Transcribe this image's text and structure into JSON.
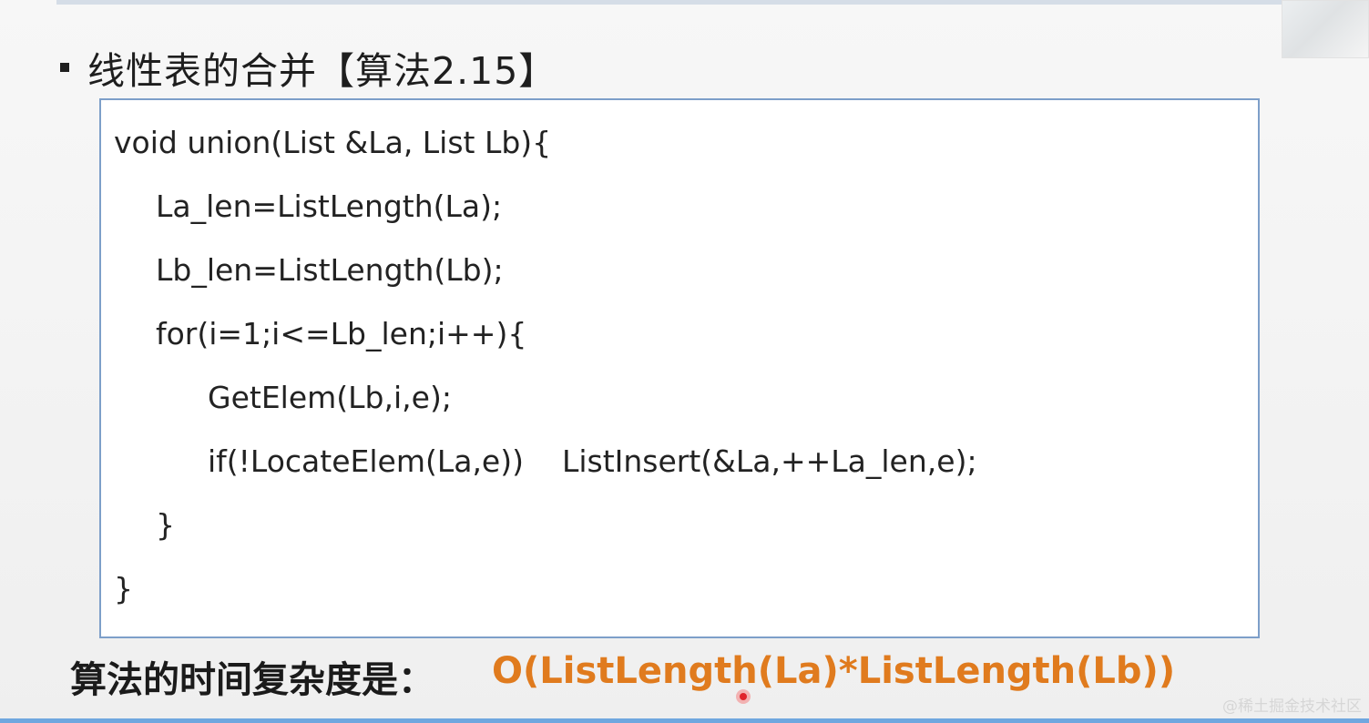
{
  "slide": {
    "heading": "线性表的合并【算法2.15】",
    "code_lines": [
      "void union(List &La, List Lb){",
      "La_len=ListLength(La);",
      "Lb_len=ListLength(Lb);",
      "for(i=1;i<=Lb_len;i++){",
      "GetElem(Lb,i,e);",
      "if(!LocateElem(La,e))    ListInsert(&La,++La_len,e);",
      "}",
      "}"
    ],
    "complexity_label": "算法的时间复杂度是：",
    "complexity_formula": "O(ListLength(La)*ListLength(Lb))",
    "watermark": "@稀土掘金技术社区"
  },
  "colors": {
    "formula": "#e07b1e",
    "box_border": "#7d9fc9",
    "bottom_bar": "#6fa7df"
  },
  "icons": {
    "bullet": "square-bullet-icon",
    "cursor": "cursor-dot-icon"
  }
}
